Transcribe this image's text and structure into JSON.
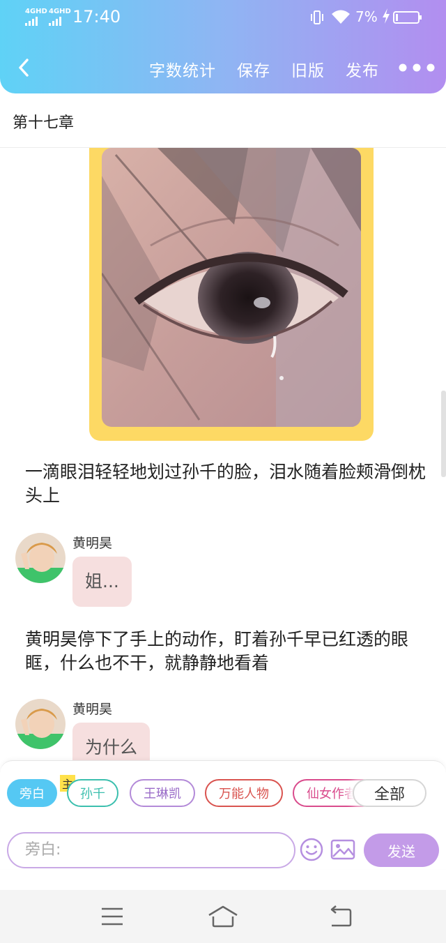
{
  "status_bar": {
    "sim1": "4GHD",
    "sim2": "4GHD",
    "time": "17:40",
    "battery_percent": "7%",
    "icons": [
      "signal-icon",
      "vibrate-icon",
      "wifi-icon",
      "charging-icon",
      "battery-icon"
    ]
  },
  "toolbar": {
    "word_count_label": "字数统计",
    "save_label": "保存",
    "old_version_label": "旧版",
    "publish_label": "发布",
    "icons": [
      "back-icon",
      "more-icon"
    ]
  },
  "chapter": {
    "title": "第十七章"
  },
  "story": {
    "narration_1": "一滴眼泪轻轻地划过孙千的脸，泪水随着脸颊滑倒枕头上",
    "message_1": {
      "speaker": "黄明昊",
      "text": "姐..."
    },
    "narration_2": "黄明昊停下了手上的动作，盯着孙千早已红透的眼眶，什么也不干，就静静地看着",
    "message_2": {
      "speaker": "黄明昊",
      "text": "为什么"
    }
  },
  "roles": {
    "items": [
      "旁白",
      "孙千",
      "王琳凯",
      "万能人物",
      "仙女作者"
    ],
    "main_mark": "主",
    "all_label": "全部",
    "selected": "旁白"
  },
  "composer": {
    "placeholder": "旁白:",
    "send_label": "发送",
    "icons": [
      "emoji-icon",
      "image-icon"
    ]
  },
  "system_nav": {
    "icons": [
      "menu-icon",
      "home-icon",
      "back-nav-icon"
    ]
  },
  "colors": {
    "header_gradient_start": "#5fd2f6",
    "header_gradient_end": "#b28ef0",
    "photo_frame": "#fdd964",
    "bubble": "#f6dfdf",
    "active_chip": "#55c8f3",
    "send_button": "#c39be8",
    "chip_sunqian": "#3bbfae",
    "chip_wanglinkai": "#b38ad8",
    "chip_wanneng": "#d9534f",
    "chip_xiannv": "#d94b8c"
  }
}
